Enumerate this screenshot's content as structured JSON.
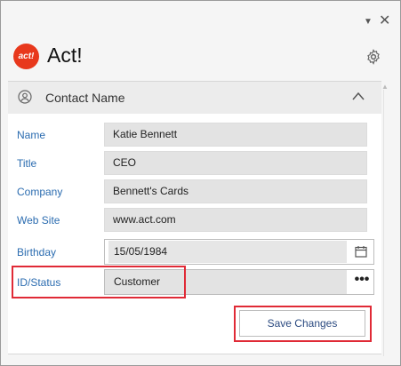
{
  "window": {
    "minimize_glyph": "▼",
    "close_glyph": "✕"
  },
  "app": {
    "logo_text": "act!",
    "title": "Act!"
  },
  "section": {
    "title": "Contact Name"
  },
  "fields": [
    {
      "label": "Name",
      "value": "Katie Bennett"
    },
    {
      "label": "Title",
      "value": "CEO"
    },
    {
      "label": "Company",
      "value": "Bennett's Cards"
    },
    {
      "label": "Web Site",
      "value": "www.act.com"
    },
    {
      "label": "Birthday",
      "value": "15/05/1984"
    },
    {
      "label": "ID/Status",
      "value": "Customer"
    }
  ],
  "more_button": {
    "label": "•••"
  },
  "save_button": {
    "label": "Save Changes"
  },
  "colors": {
    "label_blue": "#2b6cb0",
    "highlight_red": "#e02a36",
    "logo_red": "#e8381c"
  },
  "icons": [
    "settings-gear-icon",
    "person-icon",
    "chevron-up-icon",
    "calendar-icon"
  ]
}
